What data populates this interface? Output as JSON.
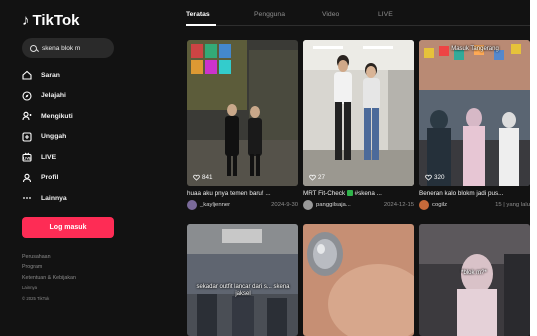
{
  "app": {
    "name": "TikTok"
  },
  "search": {
    "value": "skena blok m"
  },
  "nav": [
    {
      "label": "Saran"
    },
    {
      "label": "Jelajahi"
    },
    {
      "label": "Mengikuti"
    },
    {
      "label": "Unggah"
    },
    {
      "label": "LIVE"
    },
    {
      "label": "Profil"
    },
    {
      "label": "Lainnya"
    }
  ],
  "login_label": "Log masuk",
  "footer": {
    "links": [
      "Perusahaan",
      "Program",
      "Ketentuan & Kebijakan"
    ],
    "more": "Lainnya",
    "copyright": "© 2025 TikTok"
  },
  "tabs": [
    "Teratas",
    "Pengguna",
    "Video",
    "LIVE"
  ],
  "videos": [
    {
      "views": "841",
      "caption": "huaa aku pnya temen baru! ...",
      "user": "_kayljenner",
      "date": "2024-9-30",
      "avatar_color": "#7a6a9a"
    },
    {
      "views": "27",
      "caption_a": "MRT Fit-Check",
      "caption_b": "#skena ...",
      "user": "panggilsaja...",
      "date": "2024-12-15",
      "avatar_color": "#999999"
    },
    {
      "views": "320",
      "caption": "Beneran kalo blokm jadi pus...",
      "user": "cogilz",
      "date": "15 | yang lalu",
      "overlay": "Masuk Tangerang",
      "avatar_color": "#c76a3a"
    },
    {
      "overlay": "sekadar outfit lancar dari s...  skena jaksel"
    },
    {},
    {
      "overlay": "*blok m?*"
    }
  ],
  "colors": {
    "accent": "#fe2c55",
    "background": "#121212"
  }
}
